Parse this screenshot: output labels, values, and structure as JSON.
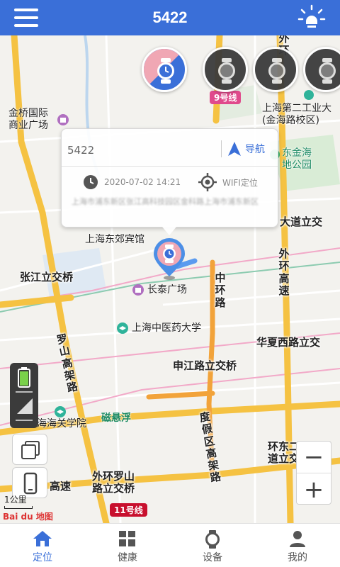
{
  "header": {
    "title": "5422",
    "menu_icon": "menu-icon",
    "light_icon": "light-bulb-icon"
  },
  "map": {
    "pois": [
      {
        "id": "jinqiao",
        "text": "金桥国际\n商业广场"
      },
      {
        "id": "dongjiao",
        "text": "上海东郊宾馆"
      },
      {
        "id": "changtai",
        "text": "长泰广场"
      },
      {
        "id": "tcm",
        "text": "上海中医药大学"
      },
      {
        "id": "jinhai-park",
        "text": "东金海\n地公园"
      },
      {
        "id": "polytech",
        "text": "上海第二工业大\n(金海路校区)"
      },
      {
        "id": "customs",
        "text": "海海关学院"
      },
      {
        "id": "maglev",
        "text": "磁悬浮"
      }
    ],
    "roads": [
      {
        "id": "zhangjiang",
        "text": "张江立交桥"
      },
      {
        "id": "middle-ring",
        "text": "中环路"
      },
      {
        "id": "outer-ring",
        "text": "外环高速"
      },
      {
        "id": "outer-ring-top",
        "text": "外环"
      },
      {
        "id": "dadao",
        "text": "大道立交"
      },
      {
        "id": "luoshan",
        "text": "罗山高架路"
      },
      {
        "id": "huaxia",
        "text": "华夏西路立交"
      },
      {
        "id": "shenjiang",
        "text": "申江路立交桥"
      },
      {
        "id": "dujia",
        "text": "度假区高架路"
      },
      {
        "id": "huandong",
        "text": "环东二\n道立交"
      },
      {
        "id": "outer-luoshan",
        "text": "外环罗山\n路立交桥"
      },
      {
        "id": "gaosu-left",
        "text": "高速"
      }
    ],
    "metro": [
      {
        "id": "line9",
        "text": "9号线",
        "color": "#e04a8c"
      },
      {
        "id": "line11",
        "text": "11号线",
        "color": "#c8102e"
      }
    ],
    "scale": "1公里",
    "attribution": "Bai du 地图"
  },
  "device_avatars": [
    {
      "state": "active"
    },
    {
      "state": "inactive"
    },
    {
      "state": "inactive"
    },
    {
      "state": "inactive"
    }
  ],
  "popup": {
    "device_name": "5422",
    "nav_label": "导航",
    "time": "2020-07-02 14:21",
    "location_type": "WIFI定位",
    "address": "上海市浦东新区张江高科技园区金科路上海市浦东新区"
  },
  "zoom": {
    "in": "+",
    "out": "−"
  },
  "tabs": [
    {
      "label": "定位",
      "icon": "home-icon",
      "active": true
    },
    {
      "label": "健康",
      "icon": "grid-icon",
      "active": false
    },
    {
      "label": "设备",
      "icon": "watch-icon",
      "active": false
    },
    {
      "label": "我的",
      "icon": "user-icon",
      "active": false
    }
  ],
  "colors": {
    "accent": "#3a6fd8",
    "road_major": "#f5c242",
    "road_ramp": "#f2a33a",
    "metro_pink": "#e04a8c"
  }
}
